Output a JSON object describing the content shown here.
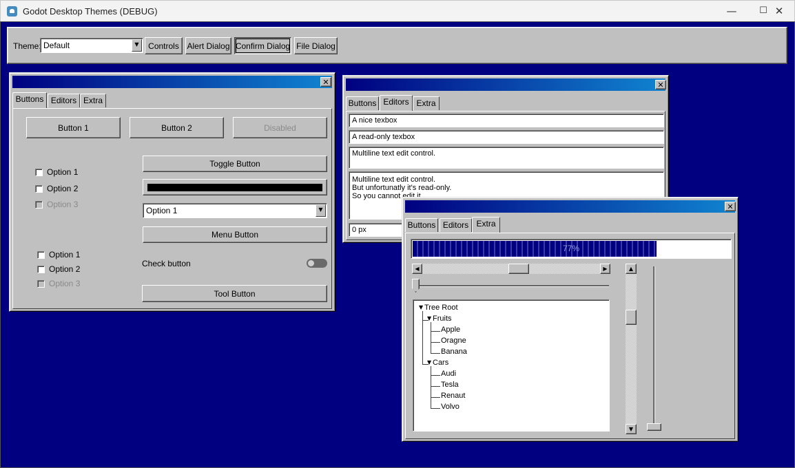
{
  "window": {
    "title": "Godot Desktop Themes (DEBUG)",
    "controls": {
      "minimize": "—",
      "maximize": "☐",
      "close": "✕"
    }
  },
  "toolbar": {
    "theme_label": "Theme:",
    "theme_value": "Default",
    "buttons": [
      "Controls",
      "Alert Dialog",
      "Confirm Dialog",
      "File Dialog"
    ]
  },
  "tabs": [
    "Buttons",
    "Editors",
    "Extra"
  ],
  "buttons_panel": {
    "button1": "Button 1",
    "button2": "Button 2",
    "disabled": "Disabled",
    "checkboxes_a": [
      "Option 1",
      "Option 2",
      "Option 3"
    ],
    "checkboxes_b": [
      "Option 1",
      "Option 2",
      "Option 3"
    ],
    "toggle": "Toggle Button",
    "option_value": "Option 1",
    "menu_button": "Menu Button",
    "check_button": "Check button",
    "tool_button": "Tool Button"
  },
  "editors_panel": {
    "textbox1": "A nice texbox",
    "textbox2": "A read-only texbox",
    "multiline1": "Multiline text edit control.",
    "multiline2": "Multiline text edit control.\nBut unfortunatly it's read-only.\nSo you cannot edit it",
    "spinbox": "0 px"
  },
  "extra_panel": {
    "progress": 77,
    "progress_label": "77%",
    "tree": {
      "root": "Tree Root",
      "fruits": "Fruits",
      "fruit_items": [
        "Apple",
        "Oragne",
        "Banana"
      ],
      "cars": "Cars",
      "car_items": [
        "Audi",
        "Tesla",
        "Renaut",
        "Volvo"
      ]
    }
  },
  "colors": {
    "desktop": "#000080",
    "face": "#c0c0c0",
    "title_start": "#000080",
    "title_end": "#1084d0"
  }
}
